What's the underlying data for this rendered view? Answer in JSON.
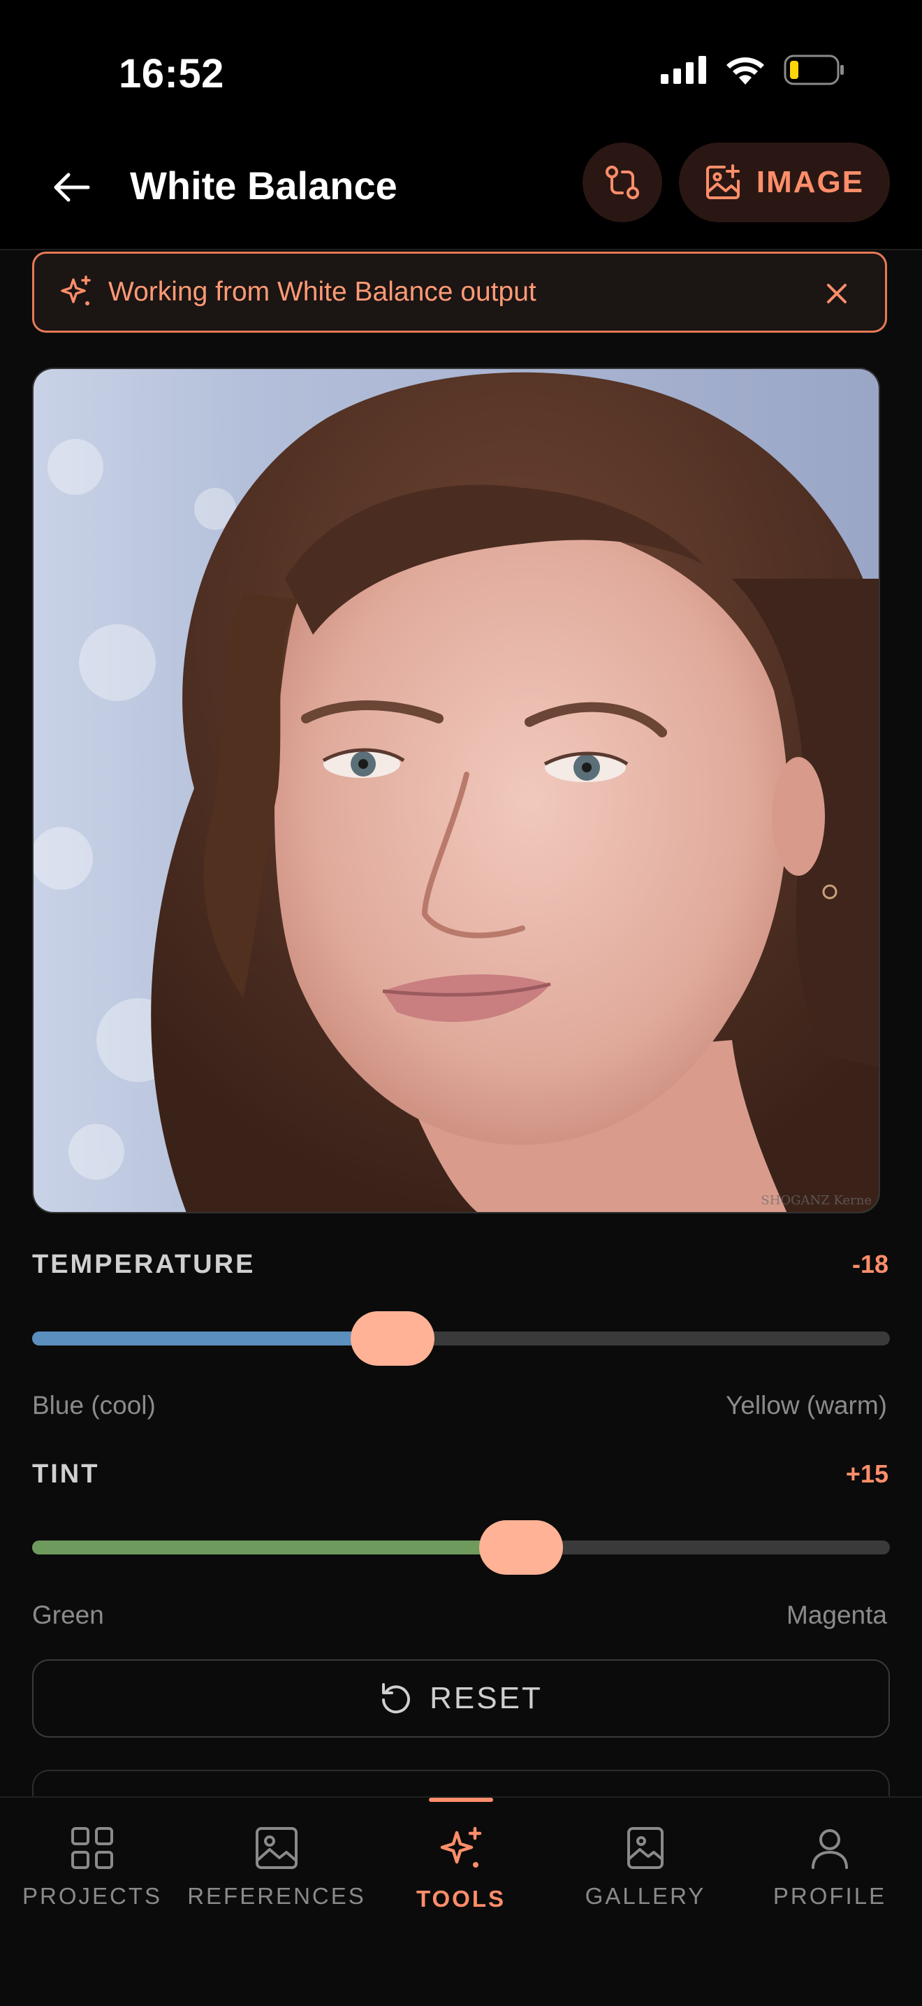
{
  "status_bar": {
    "time": "16:52"
  },
  "header": {
    "title": "White Balance",
    "image_button_label": "IMAGE"
  },
  "banner": {
    "text": "Working from White Balance output"
  },
  "photo": {
    "watermark": "SHOGANZ Kerne"
  },
  "temperature": {
    "label": "TEMPERATURE",
    "value": "-18",
    "min_label": "Blue (cool)",
    "max_label": "Yellow (warm)",
    "level_fraction": 0.42,
    "fill_color": "#5b8fbe"
  },
  "tint": {
    "label": "TINT",
    "value": "+15",
    "min_label": "Green",
    "max_label": "Magenta",
    "level_fraction": 0.57,
    "fill_color": "#6f9a5e"
  },
  "reset": {
    "label": "RESET"
  },
  "nav": {
    "items": [
      {
        "label": "PROJECTS",
        "icon": "grid-icon"
      },
      {
        "label": "REFERENCES",
        "icon": "image-icon"
      },
      {
        "label": "TOOLS",
        "icon": "sparkles-icon",
        "active": true
      },
      {
        "label": "GALLERY",
        "icon": "gallery-icon"
      },
      {
        "label": "PROFILE",
        "icon": "user-icon"
      }
    ]
  },
  "colors": {
    "accent": "#ff8e6a",
    "thumb": "#ffb295",
    "background": "#0b0b0b"
  }
}
